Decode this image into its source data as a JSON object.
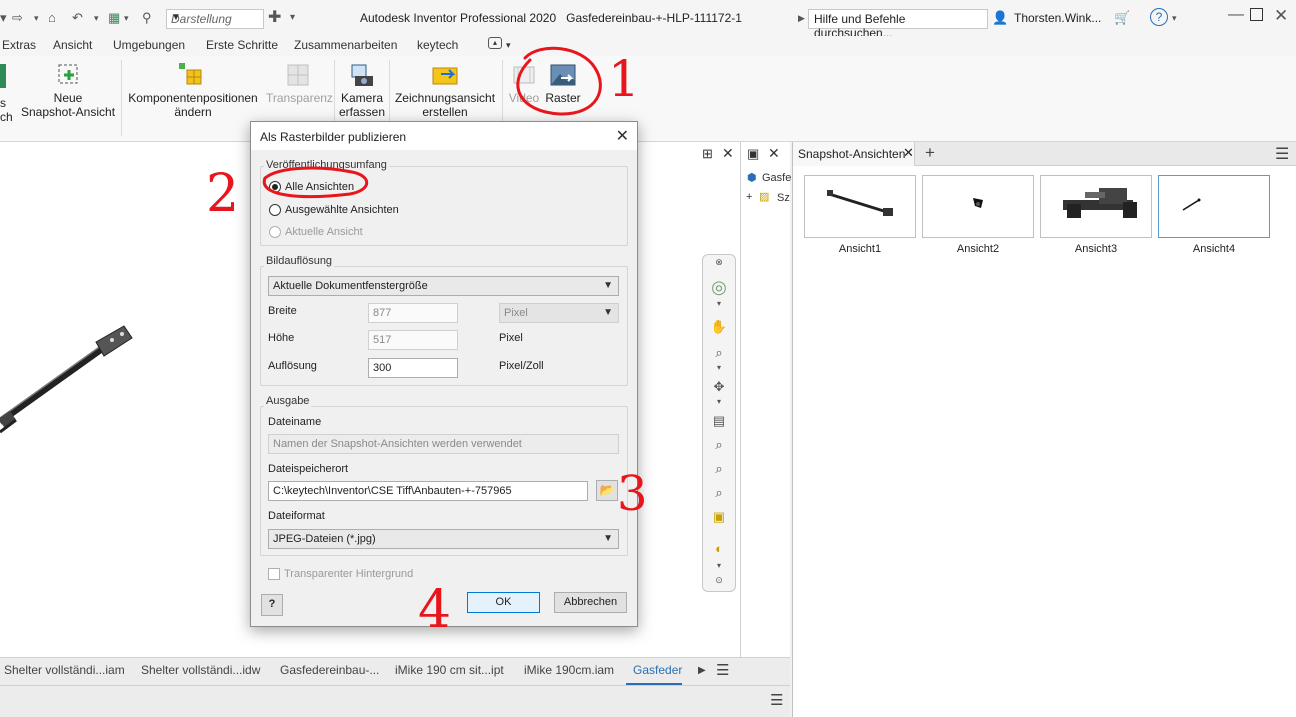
{
  "titlebar": {
    "display_combo": "Darstellung",
    "app_title": "Autodesk Inventor Professional 2020",
    "doc_title": "Gasfedereinbau-+-HLP-111172-1",
    "help_search": "Hilfe und Befehle durchsuchen...",
    "user": "Thorsten.Wink...",
    "help_symbol": "?"
  },
  "menubar": [
    "Extras",
    "Ansicht",
    "Umgebungen",
    "Erste Schritte",
    "Zusammenarbeiten",
    "keytech"
  ],
  "ribbon": {
    "btn_left_partial_1": "s",
    "btn_left_partial_2": "ch",
    "new_snapshot_1": "Neue",
    "new_snapshot_2": "Snapshot-Ansicht",
    "comp_pos_1": "Komponentenpositionen",
    "comp_pos_2": "ändern",
    "transparency": "Transparenz",
    "camera_1": "Kamera",
    "camera_2": "erfassen",
    "drawing_view_1": "Zeichnungsansicht",
    "drawing_view_2": "erstellen",
    "video": "Video",
    "raster": "Raster"
  },
  "snapshot_panel": {
    "tab_label": "Snapshot-Ansichten",
    "views": [
      "Ansicht1",
      "Ansicht2",
      "Ansicht3",
      "Ansicht4"
    ]
  },
  "browser": {
    "item1": "Gasfe",
    "item2": "Sz"
  },
  "doc_tabs": [
    "Shelter vollständi...iam",
    "Shelter vollständi...idw",
    "Gasfedereinbau-...",
    "iMike 190 cm sit...ipt",
    "iMike 190cm.iam",
    "Gasfeder"
  ],
  "dialog": {
    "title": "Als Rasterbilder publizieren",
    "scope_group": "Veröffentlichungsumfang",
    "scope_all": "Alle Ansichten",
    "scope_selected": "Ausgewählte Ansichten",
    "scope_current": "Aktuelle Ansicht",
    "resolution_group": "Bildauflösung",
    "resolution_preset": "Aktuelle Dokumentfenstergröße",
    "width_label": "Breite",
    "width_value": "877",
    "height_label": "Höhe",
    "height_value": "517",
    "resolution_label": "Auflösung",
    "resolution_value": "300",
    "unit_select": "Pixel",
    "unit_height": "Pixel",
    "unit_resolution": "Pixel/Zoll",
    "output_group": "Ausgabe",
    "filename_label": "Dateiname",
    "filename_placeholder": "Namen der Snapshot-Ansichten werden verwendet",
    "location_label": "Dateispeicherort",
    "location_value": "C:\\keytech\\Inventor\\CSE Tiff\\Anbauten-+-757965",
    "format_label": "Dateiformat",
    "format_value": "JPEG-Dateien (*.jpg)",
    "transparent_bg": "Transparenter Hintergrund",
    "ok": "OK",
    "cancel": "Abbrechen"
  },
  "annotations": {
    "n1": "1",
    "n2": "2",
    "n3": "3",
    "n4": "4",
    "color": "#e8161c"
  },
  "colors": {
    "accent": "#2a6fb5",
    "annotation": "#e8161c"
  }
}
